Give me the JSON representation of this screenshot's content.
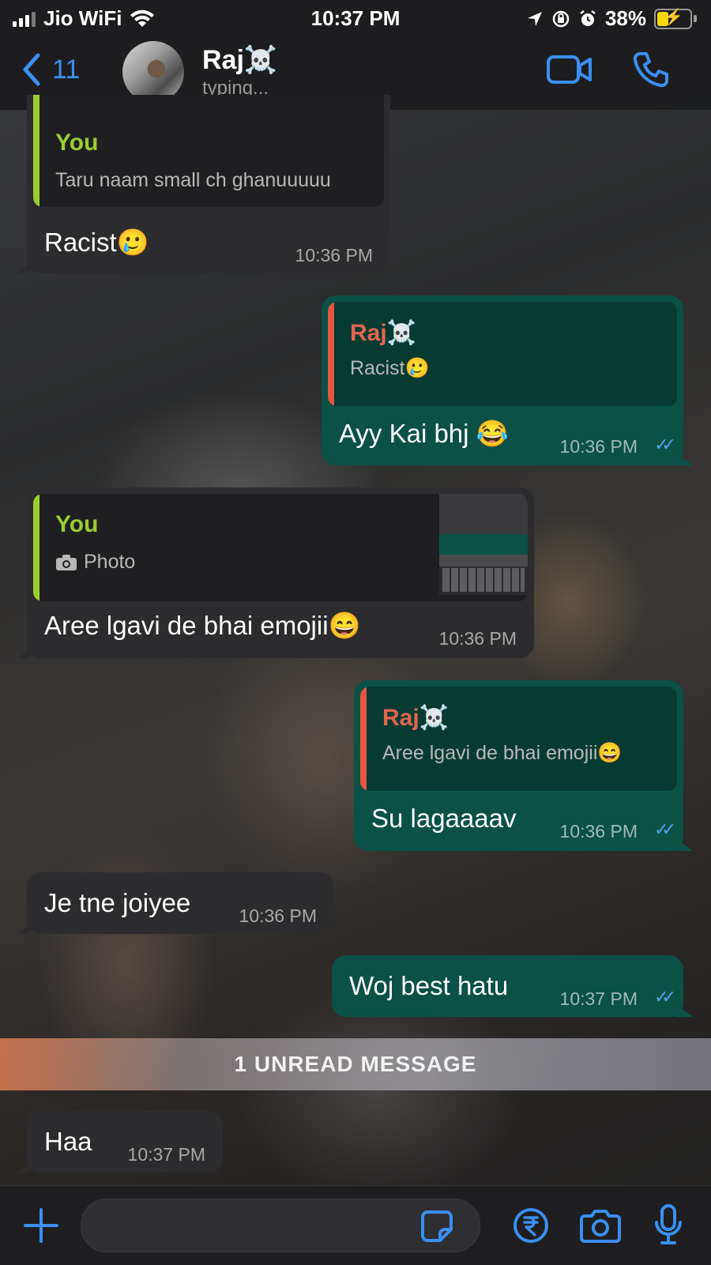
{
  "status_bar": {
    "carrier": "Jio WiFi",
    "time": "10:37 PM",
    "battery_percent": "38%",
    "battery_level": 0.38,
    "signal_bars": 3
  },
  "header": {
    "back_count": "11",
    "contact_name": "Raj☠️",
    "contact_status": "typing..."
  },
  "messages": [
    {
      "direction": "incoming",
      "quote_author": "You",
      "quote_text": "Taru naam small ch ghanuuuuu",
      "text": "Racist🥲",
      "time": "10:36 PM"
    },
    {
      "direction": "outgoing",
      "quote_author": "Raj☠️",
      "quote_text": "Racist🥲",
      "text": "Ayy Kai bhj 😂",
      "time": "10:36 PM",
      "read_ticks": "✓✓"
    },
    {
      "direction": "incoming",
      "quote_author": "You",
      "quote_text": "Photo",
      "quote_icon": "camera-icon",
      "text": "Aree lgavi de bhai emojii😄",
      "time": "10:36 PM"
    },
    {
      "direction": "outgoing",
      "quote_author": "Raj☠️",
      "quote_text": "Aree lgavi de bhai emojii😄",
      "text": "Su lagaaaav",
      "time": "10:36 PM",
      "read_ticks": "✓✓"
    },
    {
      "direction": "incoming",
      "text": "Je tne joiyee",
      "time": "10:36 PM"
    },
    {
      "direction": "outgoing",
      "text": "Woj best hatu",
      "time": "10:37 PM",
      "read_ticks": "✓✓"
    },
    {
      "direction": "incoming",
      "text": "Haa",
      "time": "10:37 PM"
    }
  ],
  "unread_banner": "1 UNREAD MESSAGE",
  "colors": {
    "accent": "#3a8ff0",
    "incoming_bubble": "#2c2c2e",
    "outgoing_bubble": "#0b5145",
    "quote_you": "#9acd32",
    "quote_raj": "#e06650"
  },
  "icons": {
    "back": "chevron-left-icon",
    "video": "video-call-icon",
    "phone": "phone-icon",
    "plus": "plus-icon",
    "sticker": "sticker-icon",
    "payment": "rupee-icon",
    "camera": "camera-icon",
    "mic": "microphone-icon"
  }
}
